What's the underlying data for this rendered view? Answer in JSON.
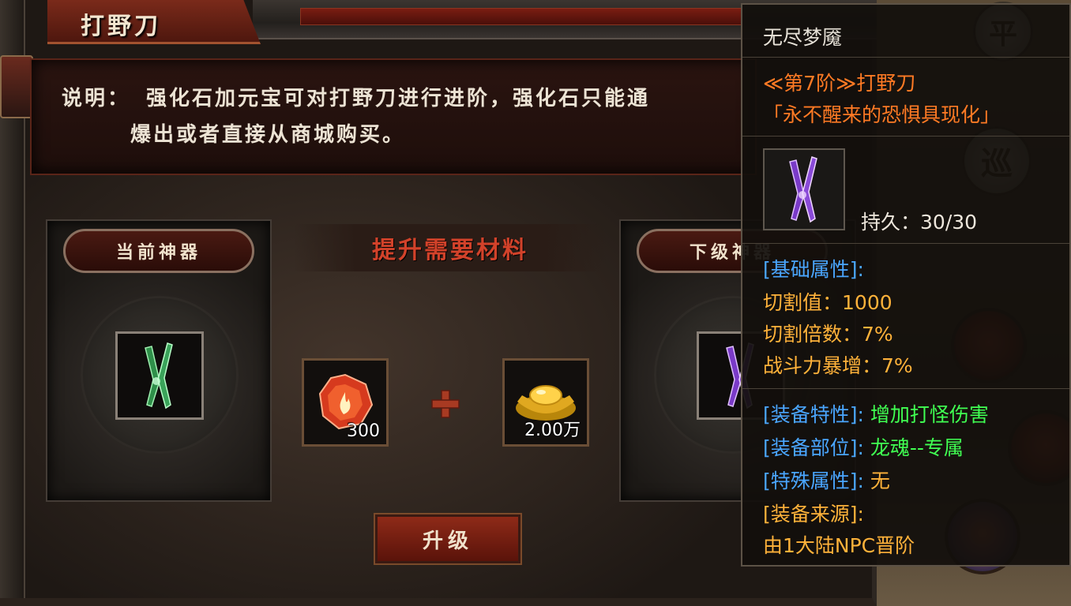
{
  "window": {
    "title": "打野刀"
  },
  "description": {
    "label": "说明：",
    "line1": "强化石加元宝可对打野刀进行进阶，强化石只能通",
    "line2": "爆出或者直接从商城购买。"
  },
  "current_card": {
    "tag": "当前神器",
    "item_icon": "green-twin-blade-icon"
  },
  "next_card": {
    "tag": "下级神器",
    "item_icon": "purple-twin-blade-icon"
  },
  "materials": {
    "header": "提升需要材料",
    "items": [
      {
        "icon": "fire-gem-icon",
        "count": "300"
      },
      {
        "icon": "gold-ingot-icon",
        "count": "2.00万"
      }
    ]
  },
  "upgrade_button": {
    "label": "升级"
  },
  "hud": {
    "button_ping": "平",
    "button_xun": "巡"
  },
  "tooltip": {
    "name": "无尽梦魇",
    "stage": "≪第7阶≫打野刀",
    "subtitle": "「永不醒来的恐惧具现化」",
    "durability_label": "持久：",
    "durability_value": "30/30",
    "base_header": "[基础属性]:",
    "stats": [
      {
        "label": "切割值：",
        "value": "1000"
      },
      {
        "label": "切割倍数：",
        "value": "7%"
      },
      {
        "label": "战斗力暴增：",
        "value": "7%"
      }
    ],
    "traits": [
      {
        "label": "[装备特性]:",
        "value": "增加打怪伤害"
      },
      {
        "label": "[装备部位]:",
        "value": "龙魂--专属"
      },
      {
        "label": "[特殊属性]:",
        "value": "无"
      },
      {
        "label": "[装备来源]:",
        "value": ""
      }
    ],
    "source_detail": "由1大陆NPC晋阶"
  },
  "colors": {
    "accent_red": "#d2422a",
    "tooltip_orange": "#ff7a24",
    "bracket_blue": "#4aa6ff",
    "value_gold": "#ffb23a",
    "value_green": "#40ff52"
  }
}
